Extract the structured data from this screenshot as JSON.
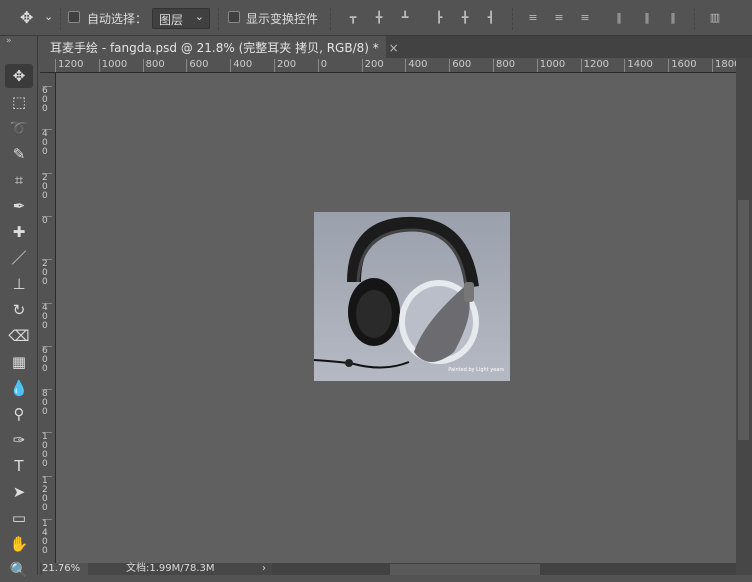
{
  "options_bar": {
    "auto_select_label": "自动选择：",
    "layer_select": "图层",
    "show_transform_label": "显示变换控件",
    "chevron": "⌄"
  },
  "document_tab": {
    "title": "耳麦手绘 - fangda.psd @ 21.8% (完整耳夹 拷贝, RGB/8) *",
    "close": "×"
  },
  "h_ruler": [
    "1200",
    "1000",
    "800",
    "600",
    "400",
    "200",
    "0",
    "200",
    "400",
    "600",
    "800",
    "1000",
    "1200",
    "1400",
    "1600",
    "1800"
  ],
  "v_ruler": [
    "600",
    "400",
    "200",
    "0",
    "200",
    "400",
    "600",
    "800",
    "1000",
    "1200",
    "1400"
  ],
  "tools": [
    "move-tool",
    "marquee-tool",
    "lasso-tool",
    "quick-select-tool",
    "crop-tool",
    "eyedropper-tool",
    "healing-brush-tool",
    "brush-tool",
    "clone-stamp-tool",
    "history-brush-tool",
    "eraser-tool",
    "gradient-tool",
    "blur-tool",
    "dodge-tool",
    "pen-tool",
    "type-tool",
    "path-select-tool",
    "rectangle-tool",
    "hand-tool",
    "zoom-tool"
  ],
  "tool_glyphs": [
    "✥",
    "⬚",
    "➰",
    "✎",
    "⌗",
    "✒",
    "✚",
    "／",
    "⊥",
    "↻",
    "⌫",
    "▦",
    "💧",
    "⚲",
    "✑",
    "T",
    "➤",
    "▭",
    "✋",
    "🔍"
  ],
  "artwork": {
    "caption": "Painted by Light years"
  },
  "status": {
    "zoom": "21.76%",
    "doc_size": "文档:1.99M/78.3M",
    "arrow": "›"
  }
}
